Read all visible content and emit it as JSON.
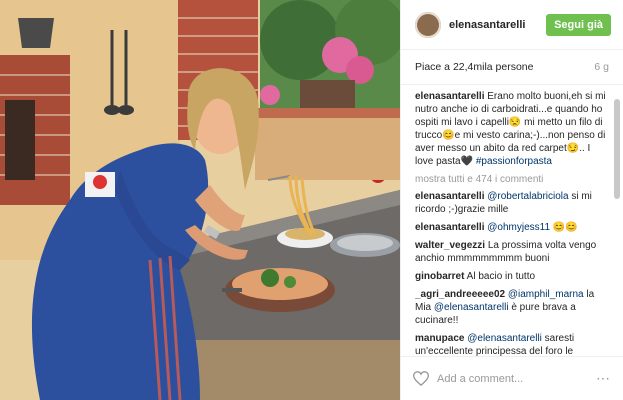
{
  "post": {
    "username": "elenasantarelli",
    "follow_label": "Segui già",
    "likes_text": "Piace a 22,4mila persone",
    "age": "6 g",
    "caption_user": "elenasantarelli",
    "caption_text": " Erano molto buoni,eh si mi nutro anche io di carboidrati...e quando ho ospiti mi lavo i capelli😒 mi metto un filo di trucco😊e mi vesto carina;-)...non penso di aver messo un abito da red carpet😏.. I love pasta🖤 ",
    "hashtag": "#passionforpasta",
    "view_all": "mostra tutti e 474 i commenti",
    "add_comment_placeholder": "Add a comment...",
    "more_icon": "⋯"
  },
  "comments": [
    {
      "user": "elenasantarelli",
      "mention": "@robertalabriciola",
      "text": " si mi ricordo ;-)grazie mille"
    },
    {
      "user": "elenasantarelli",
      "mention": "@ohmyjess11",
      "text": " 😊😊"
    },
    {
      "user": "walter_vegezzi",
      "mention": "",
      "text": " La prossima volta vengo anchio mmmmmmmmm buoni"
    },
    {
      "user": "ginobarret",
      "mention": "",
      "text": " Al bacio in tutto"
    },
    {
      "user": "_agri_andreeeee02",
      "mention": "@iamphil_marna",
      "text": " la Mia "
    },
    {
      "user": "manupace",
      "mention": "@elenasantarelli",
      "text": " saresti un'eccellente principessa del foro le argomentazioni non ti mancano!seguiti"
    }
  ],
  "comment5_extra_mention": "@elenasantarelli",
  "comment5_extra_text": " è pure brava a cucinare!!",
  "colors": {
    "follow_bg": "#70c050",
    "link": "#003569"
  }
}
